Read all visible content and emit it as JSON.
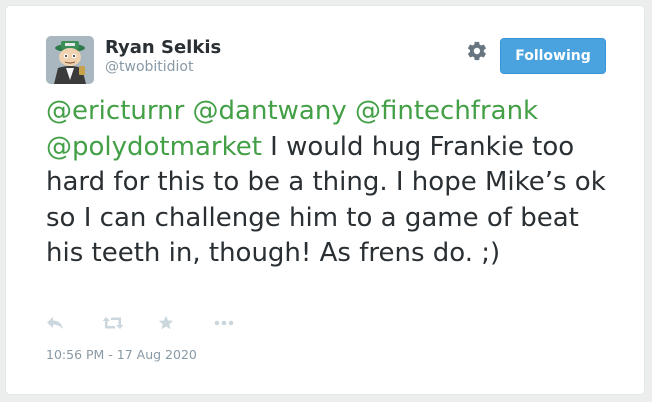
{
  "author": {
    "name": "Ryan Selkis",
    "handle": "@twobitidiot"
  },
  "follow_button": {
    "label": "Following"
  },
  "tweet": {
    "mentions": [
      "@ericturnr",
      "@dantwany",
      "@fintechfrank",
      "@polydotmarket"
    ],
    "body": "I would hug Frankie too hard for this to be a thing. I hope Mike’s ok so I can challenge him to a game of beat his teeth in, though! As frens do. ;)"
  },
  "actions": {
    "icons": [
      "reply-icon",
      "retweet-icon",
      "favorite-icon",
      "more-icon"
    ]
  },
  "timestamp": "10:56 PM - 17 Aug 2020",
  "colors": {
    "mention": "#43a047",
    "follow_button_bg": "#4aa3df",
    "text": "#292f33",
    "muted": "#8899a6"
  }
}
